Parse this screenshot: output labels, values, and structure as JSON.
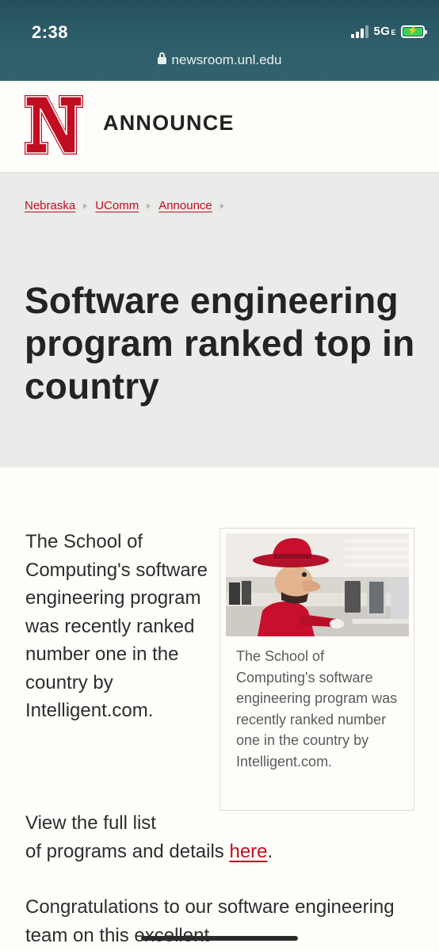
{
  "status_bar": {
    "time": "2:38",
    "network": "5G",
    "network_suffix": "E",
    "battery_charging": true
  },
  "browser": {
    "url": "newsroom.unl.edu"
  },
  "header": {
    "logo_letter": "N",
    "site_name": "ANNOUNCE"
  },
  "breadcrumb": {
    "items": [
      "Nebraska",
      "UComm",
      "Announce"
    ]
  },
  "article": {
    "title": "Software engineering program ranked top in country",
    "paragraph_1": "The School of Computing's software engineering program was recently ranked number one in the country by Intelligent.com.",
    "paragraph_2_before_link": "View the full list of programs and details ",
    "paragraph_2_link": "here",
    "paragraph_2_after_link": ".",
    "paragraph_3": "Congratulations to our software engineering team on this excellent",
    "figure_caption": "The School of Computing's software engineering program was recently ranked number one in the country by Intelligent.com."
  },
  "colors": {
    "brand_red": "#c10d21",
    "topbar": "#2f5f6b",
    "hero_bg": "#ebebe9"
  }
}
